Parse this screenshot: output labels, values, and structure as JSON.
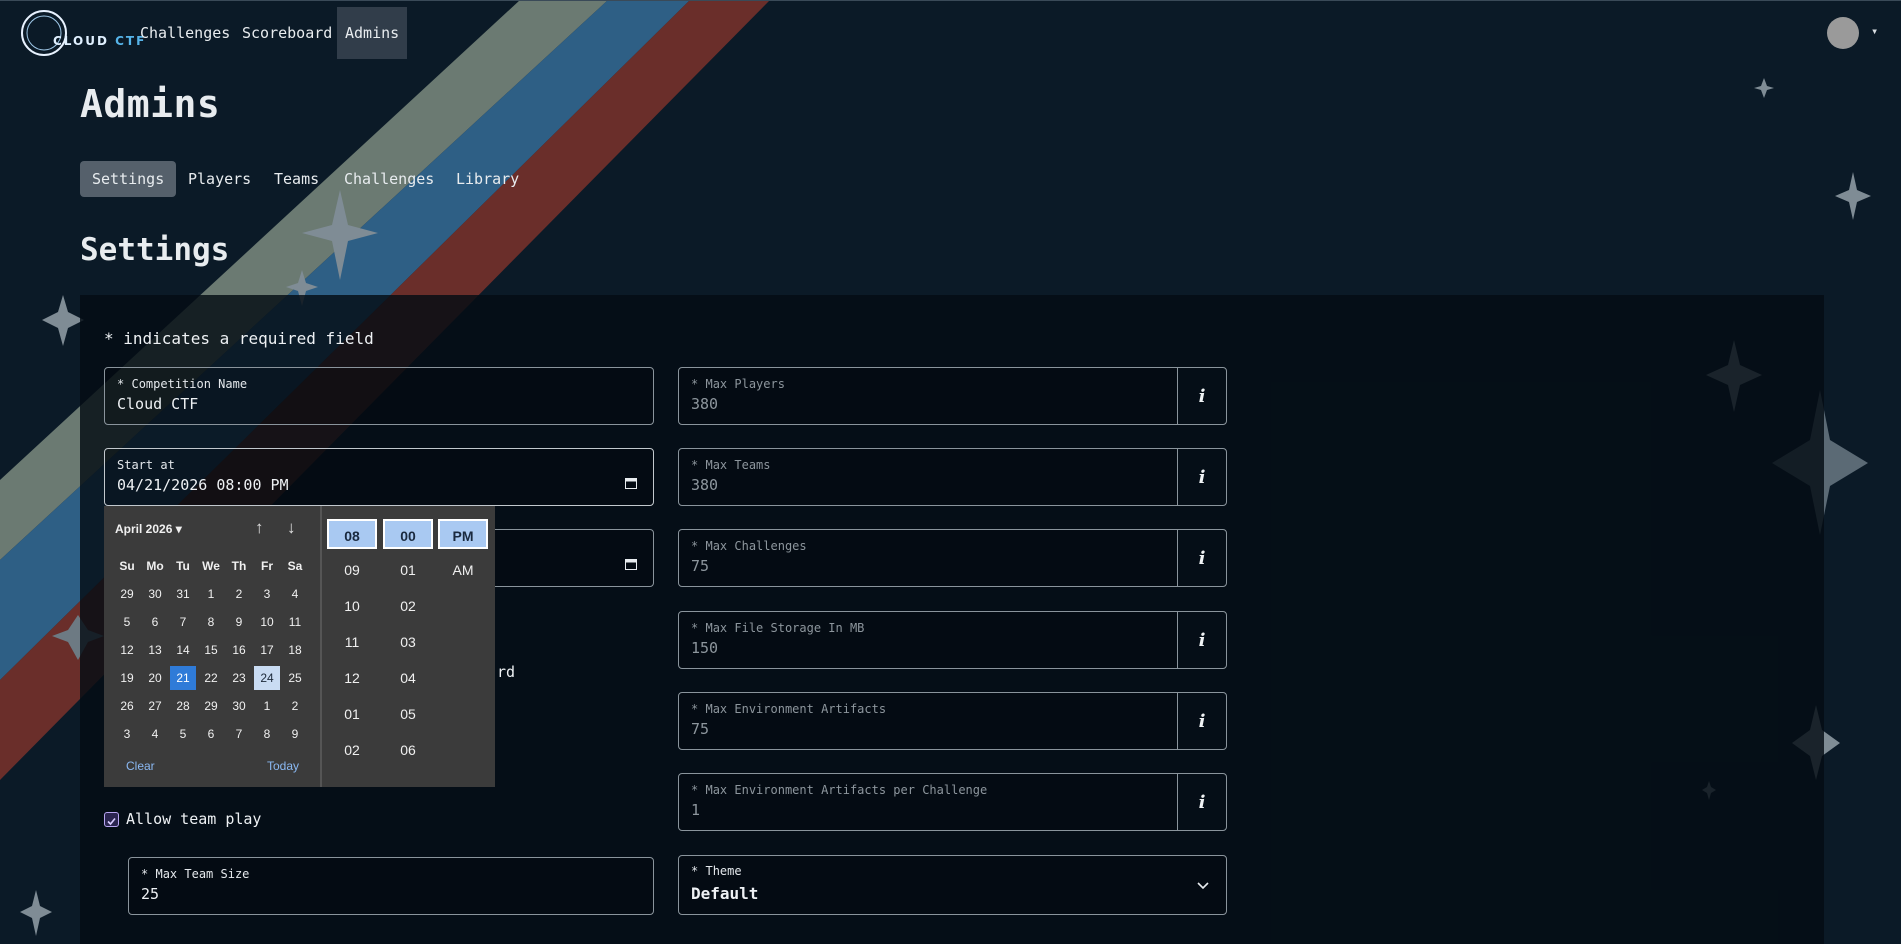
{
  "nav": {
    "logo": {
      "word1": "CLOUD",
      "word2": "CTF"
    },
    "items": [
      {
        "label": "Challenges"
      },
      {
        "label": "Scoreboard"
      },
      {
        "label": "Admins",
        "active": true
      }
    ],
    "user_icon": "user-avatar-icon",
    "dropdown_icon": "caret-down-icon"
  },
  "page": {
    "title": "Admins",
    "tabs": [
      {
        "label": "Settings",
        "active": true
      },
      {
        "label": "Players"
      },
      {
        "label": "Teams"
      },
      {
        "label": "Challenges"
      },
      {
        "label": "Library"
      }
    ],
    "section_title": "Settings",
    "required_note": "* indicates a required field"
  },
  "form": {
    "competition_name": {
      "label": "Competition Name",
      "required_mark": "*",
      "value": "Cloud CTF"
    },
    "start_at": {
      "label": "Start at",
      "value": "04/21/2026 08:00 PM"
    },
    "max_players": {
      "label": "Max Players",
      "required_mark": "*",
      "placeholder": "380"
    },
    "max_teams": {
      "label": "Max Teams",
      "required_mark": "*",
      "placeholder": "380"
    },
    "max_challenges": {
      "label": "Max Challenges",
      "required_mark": "*",
      "placeholder": "75"
    },
    "max_file_storage": {
      "label": "Max File Storage In MB",
      "required_mark": "*",
      "placeholder": "150"
    },
    "max_env_artifacts": {
      "label": "Max Environment Artifacts",
      "required_mark": "*",
      "placeholder": "75"
    },
    "max_env_artifacts_per_challenge": {
      "label": "Max Environment Artifacts per Challenge",
      "required_mark": "*",
      "placeholder": "1"
    },
    "info_button": "i",
    "partial_label_suffix": "rd",
    "allow_team_play": {
      "label": "Allow team play",
      "checked": true
    },
    "max_team_size": {
      "label": "Max Team Size",
      "required_mark": "*",
      "value": "25"
    },
    "theme": {
      "label": "Theme",
      "required_mark": "*",
      "value": "Default"
    }
  },
  "datepicker": {
    "month_label": "April 2026",
    "weekdays": [
      "Su",
      "Mo",
      "Tu",
      "We",
      "Th",
      "Fr",
      "Sa"
    ],
    "weeks": [
      [
        "29",
        "30",
        "31",
        "1",
        "2",
        "3",
        "4"
      ],
      [
        "5",
        "6",
        "7",
        "8",
        "9",
        "10",
        "11"
      ],
      [
        "12",
        "13",
        "14",
        "15",
        "16",
        "17",
        "18"
      ],
      [
        "19",
        "20",
        "21",
        "22",
        "23",
        "24",
        "25"
      ],
      [
        "26",
        "27",
        "28",
        "29",
        "30",
        "1",
        "2"
      ],
      [
        "3",
        "4",
        "5",
        "6",
        "7",
        "8",
        "9"
      ]
    ],
    "selected_day": "21",
    "today_day": "24",
    "clear_label": "Clear",
    "today_label": "Today",
    "hours": [
      "08",
      "09",
      "10",
      "11",
      "12",
      "01",
      "02"
    ],
    "minutes": [
      "00",
      "01",
      "02",
      "03",
      "04",
      "05",
      "06"
    ],
    "meridiem": [
      "PM",
      "AM"
    ],
    "selected_hour": "08",
    "selected_minute": "00",
    "selected_meridiem": "PM"
  },
  "colors": {
    "background": "#0b1a27",
    "stripe_gray": "#6b7a72",
    "stripe_blue": "#2e5f85",
    "stripe_red": "#6a2e2a",
    "accent_selected": "#2f7bd8"
  }
}
